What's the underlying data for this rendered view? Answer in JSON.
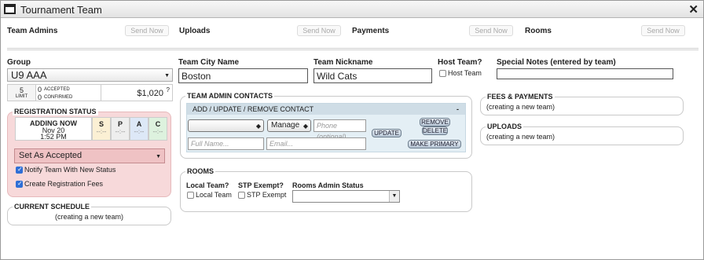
{
  "window": {
    "title": "Tournament Team",
    "close_label": "✕"
  },
  "header": {
    "items": [
      {
        "label": "Team Admins",
        "button": "Send Now"
      },
      {
        "label": "Uploads",
        "button": "Send Now"
      },
      {
        "label": "Payments",
        "button": "Send Now"
      },
      {
        "label": "Rooms",
        "button": "Send Now"
      }
    ]
  },
  "group": {
    "label": "Group",
    "selected": "U9 AAA",
    "limit_value": "5",
    "limit_label": "LIMIT",
    "accepted_value": "0",
    "accepted_label": "ACCEPTED",
    "confirmed_value": "0",
    "confirmed_label": "CONFIRMED",
    "fee": "$1,020",
    "fee_help": "?"
  },
  "team": {
    "city_label": "Team City Name",
    "city_value": "Boston",
    "nickname_label": "Team Nickname",
    "nickname_value": "Wild Cats",
    "host_label": "Host Team?",
    "host_checkbox_label": "Host Team",
    "notes_label": "Special Notes (entered by team)",
    "notes_value": ""
  },
  "registration_status": {
    "title": "REGISTRATION STATUS",
    "state_line1": "ADDING NOW",
    "state_line2": "Nov 20",
    "state_line3": "1:52 PM",
    "cells": [
      {
        "letter": "S",
        "value": "--:--",
        "color": "#fbf0d4"
      },
      {
        "letter": "P",
        "value": "--:--",
        "color": "#eeeeee"
      },
      {
        "letter": "A",
        "value": "--:--",
        "color": "#dde8f7"
      },
      {
        "letter": "C",
        "value": "--:--",
        "color": "#ddf2de"
      }
    ],
    "action_selected": "Set As Accepted",
    "notify_label": "Notify Team With New Status",
    "fees_label": "Create Registration Fees",
    "panel_color": "#f7d9da"
  },
  "current_schedule": {
    "title": "CURRENT SCHEDULE",
    "text": "(creating a new team)"
  },
  "admin_contacts": {
    "title": "TEAM ADMIN CONTACTS",
    "bar_label": "ADD / UPDATE / REMOVE CONTACT",
    "collapse_label": "-",
    "contact_select": "",
    "role_select": "Manage",
    "phone_placeholder": "Phone (optional)",
    "fullname_placeholder": "Full Name...",
    "email_placeholder": "Email...",
    "update_btn": "UPDATE",
    "remove_btn": "REMOVE",
    "delete_btn": "DELETE",
    "primary_btn": "MAKE PRIMARY"
  },
  "rooms": {
    "title": "ROOMS",
    "local_label": "Local Team?",
    "local_checkbox": "Local Team",
    "stp_label": "STP Exempt?",
    "stp_checkbox": "STP Exempt",
    "admin_status_label": "Rooms Admin Status",
    "admin_status_value": ""
  },
  "fees_payments": {
    "title": "FEES & PAYMENTS",
    "text": "(creating a new team)"
  },
  "uploads": {
    "title": "UPLOADS",
    "text": "(creating a new team)"
  }
}
